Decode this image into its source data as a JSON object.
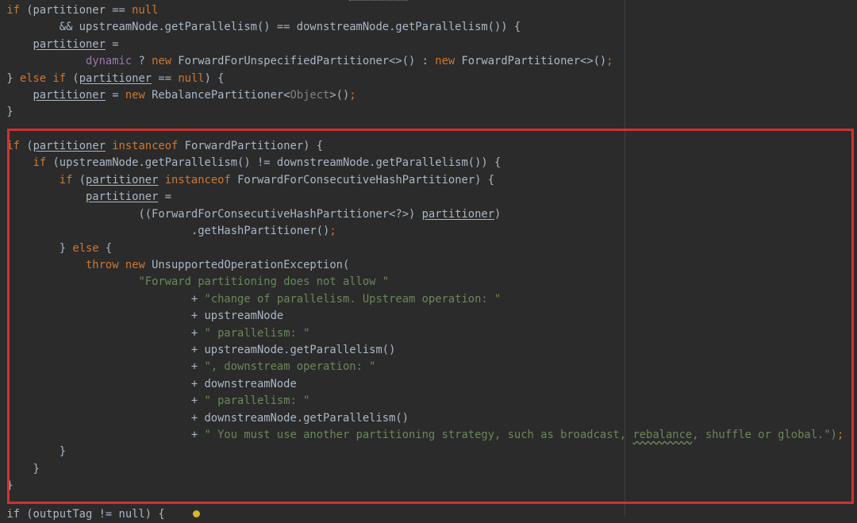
{
  "code": {
    "l1": {
      "k1": "if",
      "t1": " (partitioner == ",
      "k2": "null"
    },
    "l2": {
      "t1": "        && upstreamNode.getParallelism() == downstreamNode.getParallelism()) {"
    },
    "l3": {
      "t0": "    ",
      "f1": "partitioner",
      "t1": " ="
    },
    "l4": {
      "t0": "            ",
      "p1": "dynamic",
      "t1": " ? ",
      "k1": "new",
      "t2": " ForwardForUnspecifiedPartitioner<>() : ",
      "k2": "new",
      "t3": " ForwardPartitioner<>()",
      "k3": ";"
    },
    "l5": {
      "t1": "} ",
      "k1": "else if",
      "t2": " (",
      "f1": "partitioner",
      "t3": " == ",
      "k2": "null",
      "t4": ") {"
    },
    "l6": {
      "t0": "    ",
      "f1": "partitioner",
      "t1": " = ",
      "k1": "new",
      "t2": " RebalancePartitioner<",
      "g1": "Object",
      "t3": ">()",
      "k2": ";"
    },
    "l7": {
      "t1": "}"
    },
    "l8": {
      "k1": "if",
      "t1": " (",
      "f1": "partitioner",
      "t2": " ",
      "k2": "instanceof",
      "t3": " ForwardPartitioner) {"
    },
    "l9": {
      "t0": "    ",
      "k1": "if",
      "t1": " (upstreamNode.getParallelism() != downstreamNode.getParallelism()) {"
    },
    "l10": {
      "t0": "        ",
      "k1": "if",
      "t1": " (",
      "f1": "partitioner",
      "t2": " ",
      "k2": "instanceof",
      "t3": " ForwardForConsecutiveHashPartitioner) {"
    },
    "l11": {
      "t0": "            ",
      "f1": "partitioner",
      "t1": " ="
    },
    "l12": {
      "t0": "                    ((ForwardForConsecutiveHashPartitioner<?>) ",
      "f1": "partitioner",
      "t1": ")"
    },
    "l13": {
      "t0": "                            .getHashPartitioner()",
      "k1": ";"
    },
    "l14": {
      "t0": "        } ",
      "k1": "else",
      "t1": " {"
    },
    "l15": {
      "t0": "            ",
      "k1": "throw new",
      "t1": " UnsupportedOperationException("
    },
    "l16": {
      "t0": "                    ",
      "s1": "\"Forward partitioning does not allow \""
    },
    "l17": {
      "t0": "                            + ",
      "s1": "\"change of parallelism. Upstream operation: \""
    },
    "l18": {
      "t0": "                            + upstreamNode"
    },
    "l19": {
      "t0": "                            + ",
      "s1": "\" parallelism: \""
    },
    "l20": {
      "t0": "                            + upstreamNode.getParallelism()"
    },
    "l21": {
      "t0": "                            + ",
      "s1": "\", downstream operation: \""
    },
    "l22": {
      "t0": "                            + downstreamNode"
    },
    "l23": {
      "t0": "                            + ",
      "s1": "\" parallelism: \""
    },
    "l24": {
      "t0": "                            + downstreamNode.getParallelism()"
    },
    "l25": {
      "t0": "                            + ",
      "s1": "\" You must use another partitioning strategy, such as broadcast, ",
      "s2": "rebalance",
      "s3": ", shuffle or global.\")",
      "k1": ";"
    },
    "l26": {
      "t0": "        }"
    },
    "l27": {
      "t0": "    }"
    },
    "l28": {
      "t0": "}"
    },
    "l29": {
      "t0": "if (outputTag != null) {"
    }
  },
  "colors": {
    "background": "#2b2b2b",
    "keyword": "#cc7832",
    "string": "#6a8759",
    "text": "#a9b7c6",
    "highlight_border": "#d1322f"
  }
}
